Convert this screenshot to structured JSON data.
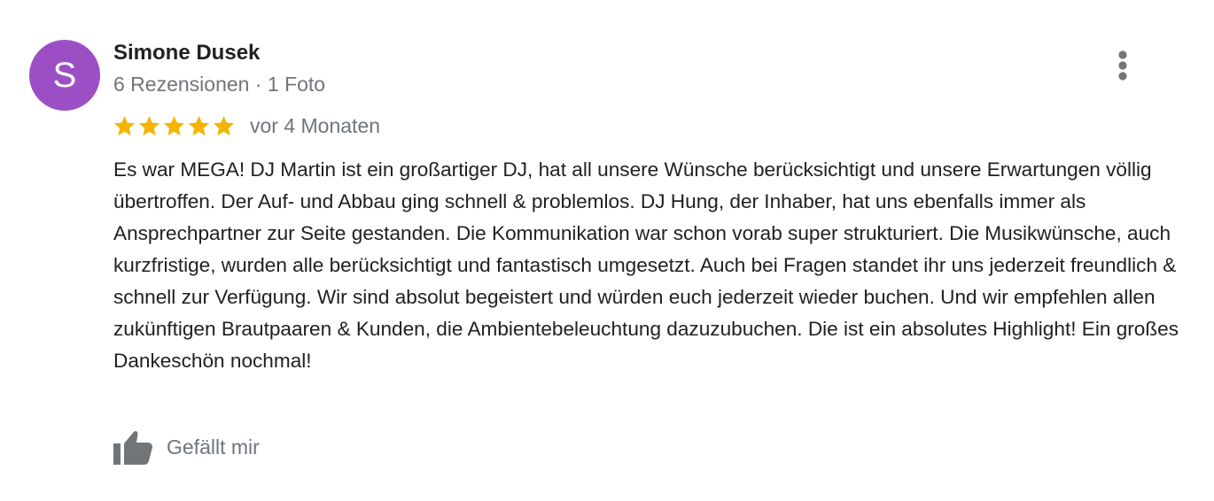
{
  "review": {
    "author": {
      "avatar_letter": "S",
      "avatar_color": "#9c4fc4",
      "name": "Simone Dusek",
      "meta": "6 Rezensionen · 1 Foto"
    },
    "rating": {
      "stars": 5,
      "max_stars": 5,
      "star_color": "#f4b400"
    },
    "time": "vor 4 Monaten",
    "text": "Es war MEGA! DJ Martin ist ein großartiger DJ, hat all unsere Wünsche berücksichtigt und unsere Erwartungen völlig übertroffen. Der Auf- und Abbau ging schnell & problemlos. DJ Hung, der Inhaber, hat uns ebenfalls immer als Ansprechpartner zur Seite gestanden. Die Kommunikation war schon vorab super strukturiert. Die Musikwünsche, auch kurzfristige, wurden alle berücksichtigt und fantastisch umgesetzt. Auch bei Fragen standet ihr uns jederzeit freundlich & schnell zur Verfügung. Wir sind absolut begeistert und würden euch jederzeit wieder buchen. Und wir empfehlen allen zukünftigen Brautpaaren & Kunden, die Ambientebeleuchtung dazuzubuchen. Die ist ein absolutes Highlight! Ein großes Dankeschön nochmal!",
    "like_label": "Gefällt mir",
    "icons": {
      "menu": "more-vert-icon",
      "like": "thumb-up-icon",
      "star": "star-icon"
    }
  }
}
